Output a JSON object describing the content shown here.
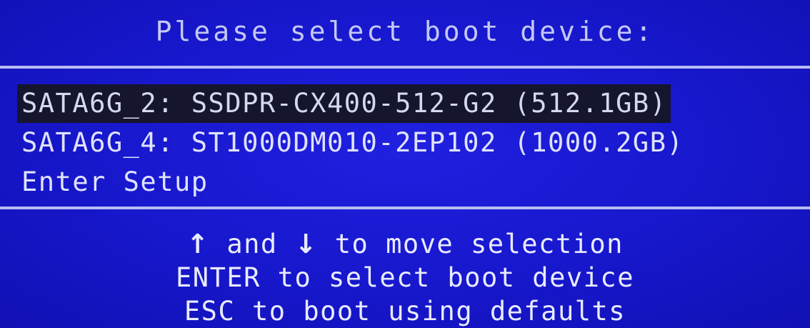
{
  "title": "Please select boot device:",
  "boot_options": [
    {
      "label": "SATA6G_2: SSDPR-CX400-512-G2 (512.1GB)",
      "selected": true
    },
    {
      "label": "SATA6G_4: ST1000DM010-2EP102 (1000.2GB)",
      "selected": false
    },
    {
      "label": "Enter Setup",
      "selected": false
    }
  ],
  "help": {
    "line1": {
      "up_arrow": "↑",
      "and": "and",
      "down_arrow": "↓",
      "rest": "to move selection"
    },
    "line2": "ENTER to select boot device",
    "line3": "ESC to boot using defaults"
  },
  "colors": {
    "background": "#1717cc",
    "selection_highlight": "#15152e",
    "text": "#e6e8ff",
    "divider": "#b8bcf2"
  }
}
